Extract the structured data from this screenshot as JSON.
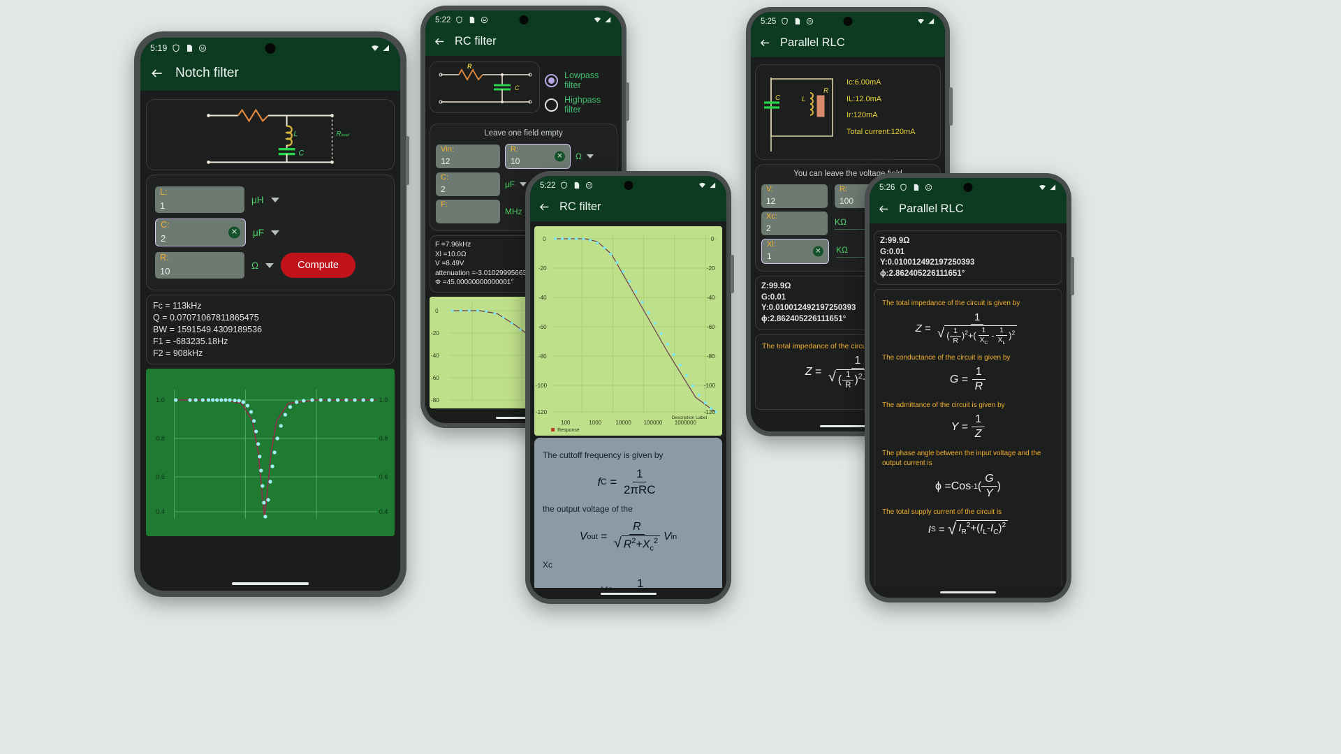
{
  "phones": [
    {
      "id": "notch-filter",
      "status": {
        "time": "5:19",
        "icons": [
          "shield-icon",
          "sd-card-icon",
          "emoji-icon"
        ],
        "right_icons": [
          "wifi-icon",
          "signal-icon"
        ]
      },
      "appbar": {
        "back": "←",
        "title": "Notch filter"
      },
      "fields": [
        {
          "label": "L:",
          "value": "1",
          "unit": "μH",
          "focused": false,
          "clear": false
        },
        {
          "label": "C:",
          "value": "2",
          "unit": "μF",
          "focused": true,
          "clear": true
        },
        {
          "label": "R:",
          "value": "10",
          "unit": "Ω",
          "focused": false,
          "clear": false
        }
      ],
      "compute_label": "Compute",
      "results": [
        "Fc = 113kHz",
        "Q = 0.07071067811865475",
        "BW = 1591549.4309189536",
        "F1 = -683235.18Hz",
        "F2 = 908kHz"
      ],
      "circuit_labels": {
        "r": "",
        "l": "L",
        "c": "C",
        "rload": "R"
      },
      "chart": {
        "yticks": [
          "1.0",
          "0.8",
          "0.6",
          "0.4"
        ],
        "yticks_right": [
          "1.0",
          "0.8",
          "0.6",
          "0.4"
        ],
        "bg": "#1f7a32",
        "point_color": "#9ff0f5",
        "line_color": "#8e2f4a"
      }
    },
    {
      "id": "rc-filter-top",
      "status": {
        "time": "5:22",
        "icons": [
          "shield-icon",
          "sd-card-icon",
          "emoji-icon"
        ],
        "right_icons": [
          "wifi-icon",
          "signal-icon"
        ]
      },
      "appbar": {
        "back": "←",
        "title": "RC filter"
      },
      "radios": [
        {
          "label": "Lowpass filter",
          "selected": true
        },
        {
          "label": "Highpass filter",
          "selected": false
        }
      ],
      "hint": "Leave one field empty",
      "fields": [
        {
          "label": "Vin:",
          "value": "12",
          "unit": "",
          "focused": false,
          "clear": false
        },
        {
          "label": "R:",
          "value": "10",
          "unit": "Ω",
          "focused": true,
          "clear": true
        },
        {
          "label": "C:",
          "value": "2",
          "unit": "μF",
          "focused": false,
          "clear": false
        },
        {
          "label": "F:",
          "value": "",
          "unit": "MHz",
          "focused": false,
          "clear": false
        }
      ],
      "results": [
        "F =7.96kHz",
        "Xl =10.0Ω",
        "V =8.49V",
        "attenuation =-3.01029995663",
        "Φ =45.00000000000001°"
      ],
      "circuit_labels": {
        "r": "R",
        "c": "C"
      },
      "chart": {
        "yticks": [
          "0",
          "-20",
          "-40",
          "-60",
          "-80"
        ],
        "bg": "#bfe08a"
      }
    },
    {
      "id": "rc-filter-graph",
      "status": {
        "time": "5:22",
        "icons": [
          "shield-icon",
          "sd-card-icon",
          "emoji-icon"
        ],
        "right_icons": [
          "wifi-icon",
          "signal-icon"
        ]
      },
      "appbar": {
        "back": "←",
        "title": "RC filter"
      },
      "chart": {
        "type": "line",
        "title": "",
        "yticks": [
          "0",
          "-20",
          "-40",
          "-60",
          "-80",
          "-100",
          "-120"
        ],
        "yticks_right": [
          "0",
          "-20",
          "-40",
          "-60",
          "-80",
          "-100",
          "-120"
        ],
        "xticks": [
          "100",
          "1000",
          "10000",
          "100000",
          "1000000"
        ],
        "xlabel": "Description Label",
        "legend": "Response",
        "bg": "#bfe08a",
        "point_color": "#7fe8f0",
        "ylim": [
          -120,
          0
        ]
      },
      "formula": {
        "t1": "The cuttoff frequency is given by",
        "t2": "the output voltage of the",
        "t3": "Xc"
      }
    },
    {
      "id": "parallel-rlc-top",
      "status": {
        "time": "5:25",
        "icons": [
          "shield-icon",
          "sd-card-icon",
          "emoji-icon"
        ],
        "right_icons": [
          "wifi-icon",
          "signal-icon"
        ]
      },
      "appbar": {
        "back": "←",
        "title": "Parallel RLC"
      },
      "circuit_values": [
        "Ic:6.00mA",
        "IL:12.0mA",
        "Ir:120mA",
        "Total current:120mA"
      ],
      "circuit_labels": {
        "c": "C",
        "l": "L",
        "r": "R"
      },
      "hint": "You can leave the voltage field",
      "fields": [
        {
          "label": "V:",
          "value": "12",
          "unit": "",
          "focused": false,
          "clear": false
        },
        {
          "label": "R:",
          "value": "100",
          "unit": "",
          "focused": false,
          "clear": false
        },
        {
          "label": "Xc:",
          "value": "2",
          "unit": "KΩ",
          "focused": false,
          "clear": false
        },
        {
          "label": "Xl:",
          "value": "1",
          "unit": "KΩ",
          "focused": true,
          "clear": true
        }
      ],
      "results": [
        "Z:99.9Ω",
        "G:0.01",
        "Y:0.010012492197250393",
        "ϕ:2.862405226111651°"
      ],
      "formula_text": "The total impedance of the circuit"
    },
    {
      "id": "parallel-rlc-formulas",
      "status": {
        "time": "5:26",
        "icons": [
          "shield-icon",
          "sd-card-icon",
          "emoji-icon"
        ],
        "right_icons": [
          "wifi-icon",
          "signal-icon"
        ]
      },
      "appbar": {
        "back": "←",
        "title": "Parallel RLC"
      },
      "results": [
        "Z:99.9Ω",
        "G:0.01",
        "Y:0.010012492197250393",
        "ϕ:2.862405226111651°"
      ],
      "formulas": [
        "The total impedance of the circuit is given by",
        "The conductance of the circuit is given by",
        "The admittance of the circuit is given by",
        "The phase angle between the input voltage and the output current is",
        "The total supply current of the circuit is"
      ]
    }
  ],
  "colors": {
    "appbar_green": "#0c3b22",
    "accent_amber": "#f2b02e",
    "unit_green": "#4fd06a",
    "compute_red": "#c0121a",
    "focus_purple": "#d3c6f0",
    "page_bg": "#e1e8e4"
  }
}
